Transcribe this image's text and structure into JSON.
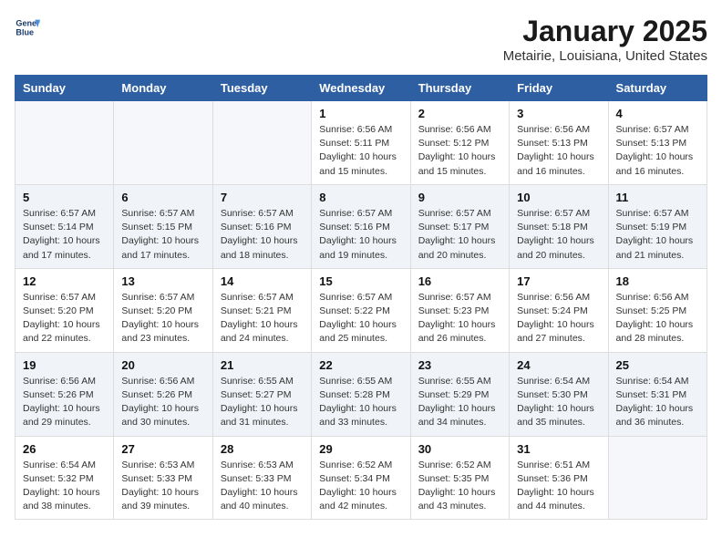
{
  "header": {
    "logo_line1": "General",
    "logo_line2": "Blue",
    "month": "January 2025",
    "location": "Metairie, Louisiana, United States"
  },
  "weekdays": [
    "Sunday",
    "Monday",
    "Tuesday",
    "Wednesday",
    "Thursday",
    "Friday",
    "Saturday"
  ],
  "weeks": [
    [
      {
        "day": "",
        "text": ""
      },
      {
        "day": "",
        "text": ""
      },
      {
        "day": "",
        "text": ""
      },
      {
        "day": "1",
        "text": "Sunrise: 6:56 AM\nSunset: 5:11 PM\nDaylight: 10 hours\nand 15 minutes."
      },
      {
        "day": "2",
        "text": "Sunrise: 6:56 AM\nSunset: 5:12 PM\nDaylight: 10 hours\nand 15 minutes."
      },
      {
        "day": "3",
        "text": "Sunrise: 6:56 AM\nSunset: 5:13 PM\nDaylight: 10 hours\nand 16 minutes."
      },
      {
        "day": "4",
        "text": "Sunrise: 6:57 AM\nSunset: 5:13 PM\nDaylight: 10 hours\nand 16 minutes."
      }
    ],
    [
      {
        "day": "5",
        "text": "Sunrise: 6:57 AM\nSunset: 5:14 PM\nDaylight: 10 hours\nand 17 minutes."
      },
      {
        "day": "6",
        "text": "Sunrise: 6:57 AM\nSunset: 5:15 PM\nDaylight: 10 hours\nand 17 minutes."
      },
      {
        "day": "7",
        "text": "Sunrise: 6:57 AM\nSunset: 5:16 PM\nDaylight: 10 hours\nand 18 minutes."
      },
      {
        "day": "8",
        "text": "Sunrise: 6:57 AM\nSunset: 5:16 PM\nDaylight: 10 hours\nand 19 minutes."
      },
      {
        "day": "9",
        "text": "Sunrise: 6:57 AM\nSunset: 5:17 PM\nDaylight: 10 hours\nand 20 minutes."
      },
      {
        "day": "10",
        "text": "Sunrise: 6:57 AM\nSunset: 5:18 PM\nDaylight: 10 hours\nand 20 minutes."
      },
      {
        "day": "11",
        "text": "Sunrise: 6:57 AM\nSunset: 5:19 PM\nDaylight: 10 hours\nand 21 minutes."
      }
    ],
    [
      {
        "day": "12",
        "text": "Sunrise: 6:57 AM\nSunset: 5:20 PM\nDaylight: 10 hours\nand 22 minutes."
      },
      {
        "day": "13",
        "text": "Sunrise: 6:57 AM\nSunset: 5:20 PM\nDaylight: 10 hours\nand 23 minutes."
      },
      {
        "day": "14",
        "text": "Sunrise: 6:57 AM\nSunset: 5:21 PM\nDaylight: 10 hours\nand 24 minutes."
      },
      {
        "day": "15",
        "text": "Sunrise: 6:57 AM\nSunset: 5:22 PM\nDaylight: 10 hours\nand 25 minutes."
      },
      {
        "day": "16",
        "text": "Sunrise: 6:57 AM\nSunset: 5:23 PM\nDaylight: 10 hours\nand 26 minutes."
      },
      {
        "day": "17",
        "text": "Sunrise: 6:56 AM\nSunset: 5:24 PM\nDaylight: 10 hours\nand 27 minutes."
      },
      {
        "day": "18",
        "text": "Sunrise: 6:56 AM\nSunset: 5:25 PM\nDaylight: 10 hours\nand 28 minutes."
      }
    ],
    [
      {
        "day": "19",
        "text": "Sunrise: 6:56 AM\nSunset: 5:26 PM\nDaylight: 10 hours\nand 29 minutes."
      },
      {
        "day": "20",
        "text": "Sunrise: 6:56 AM\nSunset: 5:26 PM\nDaylight: 10 hours\nand 30 minutes."
      },
      {
        "day": "21",
        "text": "Sunrise: 6:55 AM\nSunset: 5:27 PM\nDaylight: 10 hours\nand 31 minutes."
      },
      {
        "day": "22",
        "text": "Sunrise: 6:55 AM\nSunset: 5:28 PM\nDaylight: 10 hours\nand 33 minutes."
      },
      {
        "day": "23",
        "text": "Sunrise: 6:55 AM\nSunset: 5:29 PM\nDaylight: 10 hours\nand 34 minutes."
      },
      {
        "day": "24",
        "text": "Sunrise: 6:54 AM\nSunset: 5:30 PM\nDaylight: 10 hours\nand 35 minutes."
      },
      {
        "day": "25",
        "text": "Sunrise: 6:54 AM\nSunset: 5:31 PM\nDaylight: 10 hours\nand 36 minutes."
      }
    ],
    [
      {
        "day": "26",
        "text": "Sunrise: 6:54 AM\nSunset: 5:32 PM\nDaylight: 10 hours\nand 38 minutes."
      },
      {
        "day": "27",
        "text": "Sunrise: 6:53 AM\nSunset: 5:33 PM\nDaylight: 10 hours\nand 39 minutes."
      },
      {
        "day": "28",
        "text": "Sunrise: 6:53 AM\nSunset: 5:33 PM\nDaylight: 10 hours\nand 40 minutes."
      },
      {
        "day": "29",
        "text": "Sunrise: 6:52 AM\nSunset: 5:34 PM\nDaylight: 10 hours\nand 42 minutes."
      },
      {
        "day": "30",
        "text": "Sunrise: 6:52 AM\nSunset: 5:35 PM\nDaylight: 10 hours\nand 43 minutes."
      },
      {
        "day": "31",
        "text": "Sunrise: 6:51 AM\nSunset: 5:36 PM\nDaylight: 10 hours\nand 44 minutes."
      },
      {
        "day": "",
        "text": ""
      }
    ]
  ]
}
